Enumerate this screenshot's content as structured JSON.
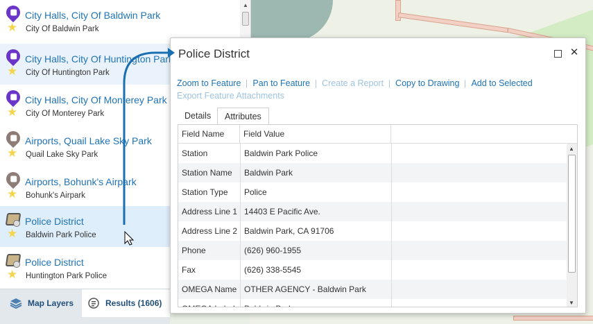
{
  "results_list": {
    "items": [
      {
        "title": "City Halls, City Of Baldwin Park",
        "subtitle": "City Of Baldwin Park",
        "icon": "purple-pin-icon"
      },
      {
        "title": "City Halls, City Of Huntington Park",
        "subtitle": "City Of Huntington Park",
        "icon": "purple-pin-icon"
      },
      {
        "title": "City Halls, City Of Monterey Park",
        "subtitle": "City Of Monterey Park",
        "icon": "purple-pin-icon"
      },
      {
        "title": "Airports, Quail Lake Sky Park",
        "subtitle": "Quail Lake Sky Park",
        "icon": "airport-pin-icon"
      },
      {
        "title": "Airports, Bohunk's Airpark",
        "subtitle": "Bohunk's Airpark",
        "icon": "airport-pin-icon"
      },
      {
        "title": "Police District",
        "subtitle": "Baldwin Park Police",
        "icon": "polygon-icon"
      },
      {
        "title": "Police District",
        "subtitle": "Huntington Park Police",
        "icon": "polygon-icon"
      }
    ]
  },
  "bottom_tabs": {
    "map_layers": "Map Layers",
    "results": "Results (1606)"
  },
  "popup": {
    "title": "Police District",
    "actions": {
      "zoom": "Zoom to Feature",
      "pan": "Pan to Feature",
      "report": "Create a Report",
      "copy": "Copy to Drawing",
      "add": "Add to Selected",
      "export": "Export Feature Attachments"
    },
    "tabs": {
      "details": "Details",
      "attributes": "Attributes"
    },
    "table": {
      "headers": {
        "field_name": "Field Name",
        "field_value": "Field Value"
      },
      "rows": [
        {
          "name": "Station",
          "value": "Baldwin Park Police"
        },
        {
          "name": "Station Name",
          "value": "Baldwin Park"
        },
        {
          "name": "Station Type",
          "value": "Police"
        },
        {
          "name": "Address Line 1",
          "value": "14403 E Pacific Ave."
        },
        {
          "name": "Address Line 2",
          "value": "Baldwin Park, CA 91706"
        },
        {
          "name": "Phone",
          "value": "(626) 960-1955"
        },
        {
          "name": "Fax",
          "value": "(626) 338-5545"
        },
        {
          "name": "OMEGA Name",
          "value": "OTHER AGENCY - Baldwin Park"
        },
        {
          "name": "OMEGA Label",
          "value": "Baldwin Park"
        }
      ]
    }
  },
  "colors": {
    "link": "#1f73b7",
    "disabled_link": "#9ec3e0",
    "selected_row": "#dfeefb",
    "arrow": "#1a6fb0"
  }
}
